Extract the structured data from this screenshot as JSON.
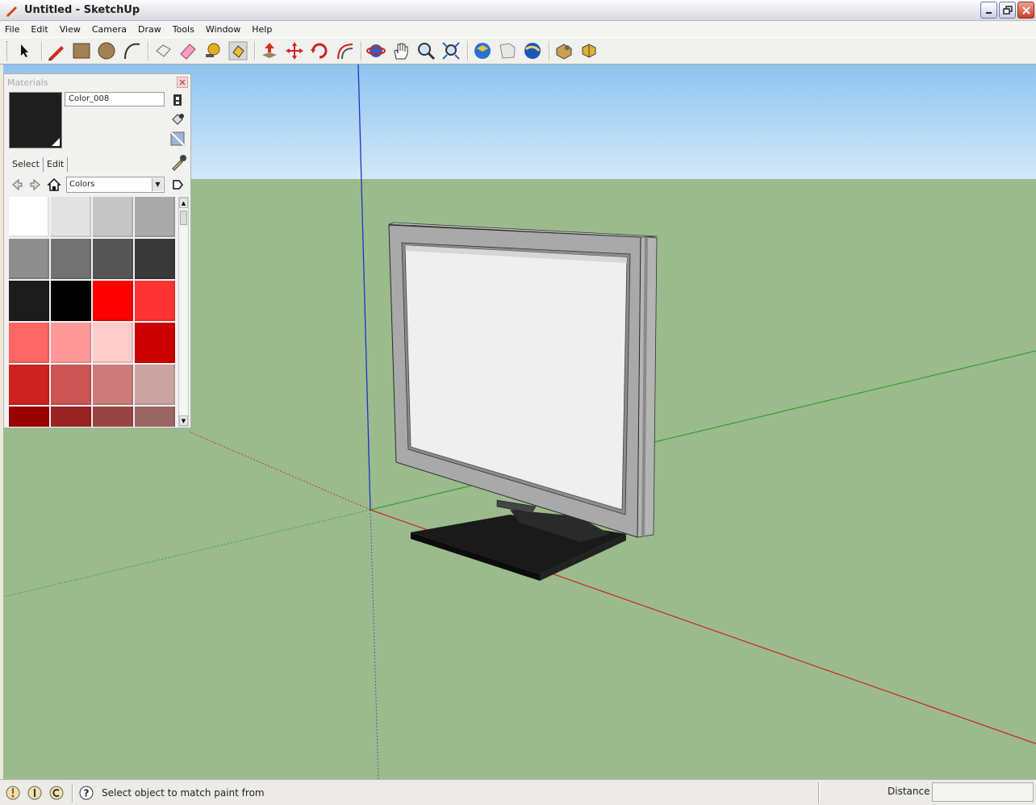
{
  "window": {
    "title": "Untitled - SketchUp"
  },
  "menu": {
    "items": [
      "File",
      "Edit",
      "View",
      "Camera",
      "Draw",
      "Tools",
      "Window",
      "Help"
    ]
  },
  "toolbar": {
    "tools": [
      "select-tool-icon",
      "line-tool-icon",
      "rectangle-tool-icon",
      "circle-tool-icon",
      "arc-tool-icon",
      "make-component-icon",
      "eraser-tool-icon",
      "tape-measure-icon",
      "paint-bucket-icon",
      "push-pull-icon",
      "move-tool-icon",
      "rotate-tool-icon",
      "offset-tool-icon",
      "orbit-tool-icon",
      "pan-tool-icon",
      "zoom-tool-icon",
      "zoom-extents-icon",
      "get-models-icon",
      "share-model-icon",
      "google-earth-icon",
      "components-icon",
      "extension-icon"
    ]
  },
  "materials": {
    "panel_title": "Materials",
    "material_name": "Color_008",
    "preview_color": "#1e1e1e",
    "tabs": [
      "Select",
      "Edit"
    ],
    "active_tab": "Select",
    "library": "Colors",
    "swatches": [
      "#ffffff",
      "#e2e2e2",
      "#c6c6c6",
      "#aaaaaa",
      "#8e8e8e",
      "#727272",
      "#555555",
      "#393939",
      "#1c1c1c",
      "#000000",
      "#ff0000",
      "#ff3333",
      "#ff6666",
      "#ff9999",
      "#ffcccc",
      "#cc0000",
      "#cc2222",
      "#cc5555",
      "#cc7a7a",
      "#cca3a3",
      "#990000",
      "#992222",
      "#994444",
      "#996666"
    ]
  },
  "viewport": {
    "sky_top": "#8dc4f0",
    "sky_bottom": "#d4e9f7",
    "ground": "#9bbb8d"
  },
  "status": {
    "message": "Select object to match paint from",
    "measure_label": "Distance",
    "measure_value": ""
  }
}
